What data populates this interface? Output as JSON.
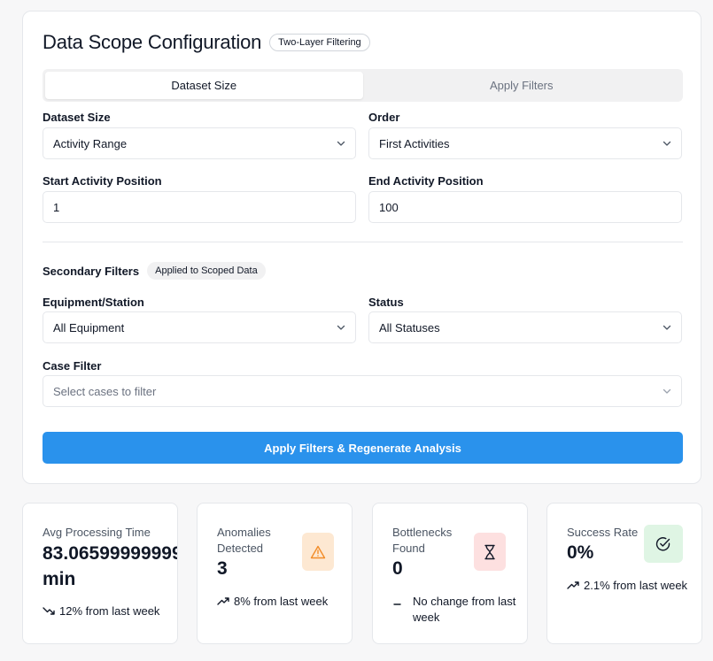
{
  "header": {
    "title": "Data Scope Configuration",
    "badge": "Two-Layer Filtering"
  },
  "tabs": [
    {
      "label": "Dataset Size",
      "active": true
    },
    {
      "label": "Apply Filters",
      "active": false
    }
  ],
  "scope": {
    "dataset_size": {
      "label": "Dataset Size",
      "value": "Activity Range"
    },
    "order": {
      "label": "Order",
      "value": "First Activities"
    },
    "start_position": {
      "label": "Start Activity Position",
      "value": "1"
    },
    "end_position": {
      "label": "End Activity Position",
      "value": "100"
    }
  },
  "secondary": {
    "title": "Secondary Filters",
    "badge": "Applied to Scoped Data",
    "equipment": {
      "label": "Equipment/Station",
      "value": "All Equipment"
    },
    "status": {
      "label": "Status",
      "value": "All Statuses"
    },
    "case_filter": {
      "label": "Case Filter",
      "placeholder": "Select cases to filter"
    }
  },
  "apply_button": "Apply Filters & Regenerate Analysis",
  "metrics": [
    {
      "label": "Avg Processing Time",
      "value_line1": "83.06599999999",
      "value_line2": "min",
      "trend": "12% from last week",
      "trend_icon": "trending-down-icon"
    },
    {
      "label_line1": "Anomalies",
      "label_line2": "Detected",
      "value": "3",
      "trend": "8% from last week",
      "trend_icon": "trending-up-icon",
      "icon": "warning-icon",
      "icon_bg": "#fde8d2",
      "icon_color": "#f28c28"
    },
    {
      "label_line1": "Bottlenecks",
      "label_line2": "Found",
      "value": "0",
      "trend_line1": "No change from last",
      "trend_line2": "week",
      "trend_icon": "minus-icon",
      "icon": "hourglass-icon",
      "icon_bg": "#fde0e0",
      "icon_color": "#111827"
    },
    {
      "label": "Success Rate",
      "value": "0%",
      "trend": "2.1% from last week",
      "trend_icon": "trending-up-icon",
      "icon": "check-circle-icon",
      "icon_bg": "#dff5e4",
      "icon_color": "#111827"
    }
  ],
  "colors": {
    "accent": "#2a92ec",
    "border": "#e5e7eb"
  }
}
